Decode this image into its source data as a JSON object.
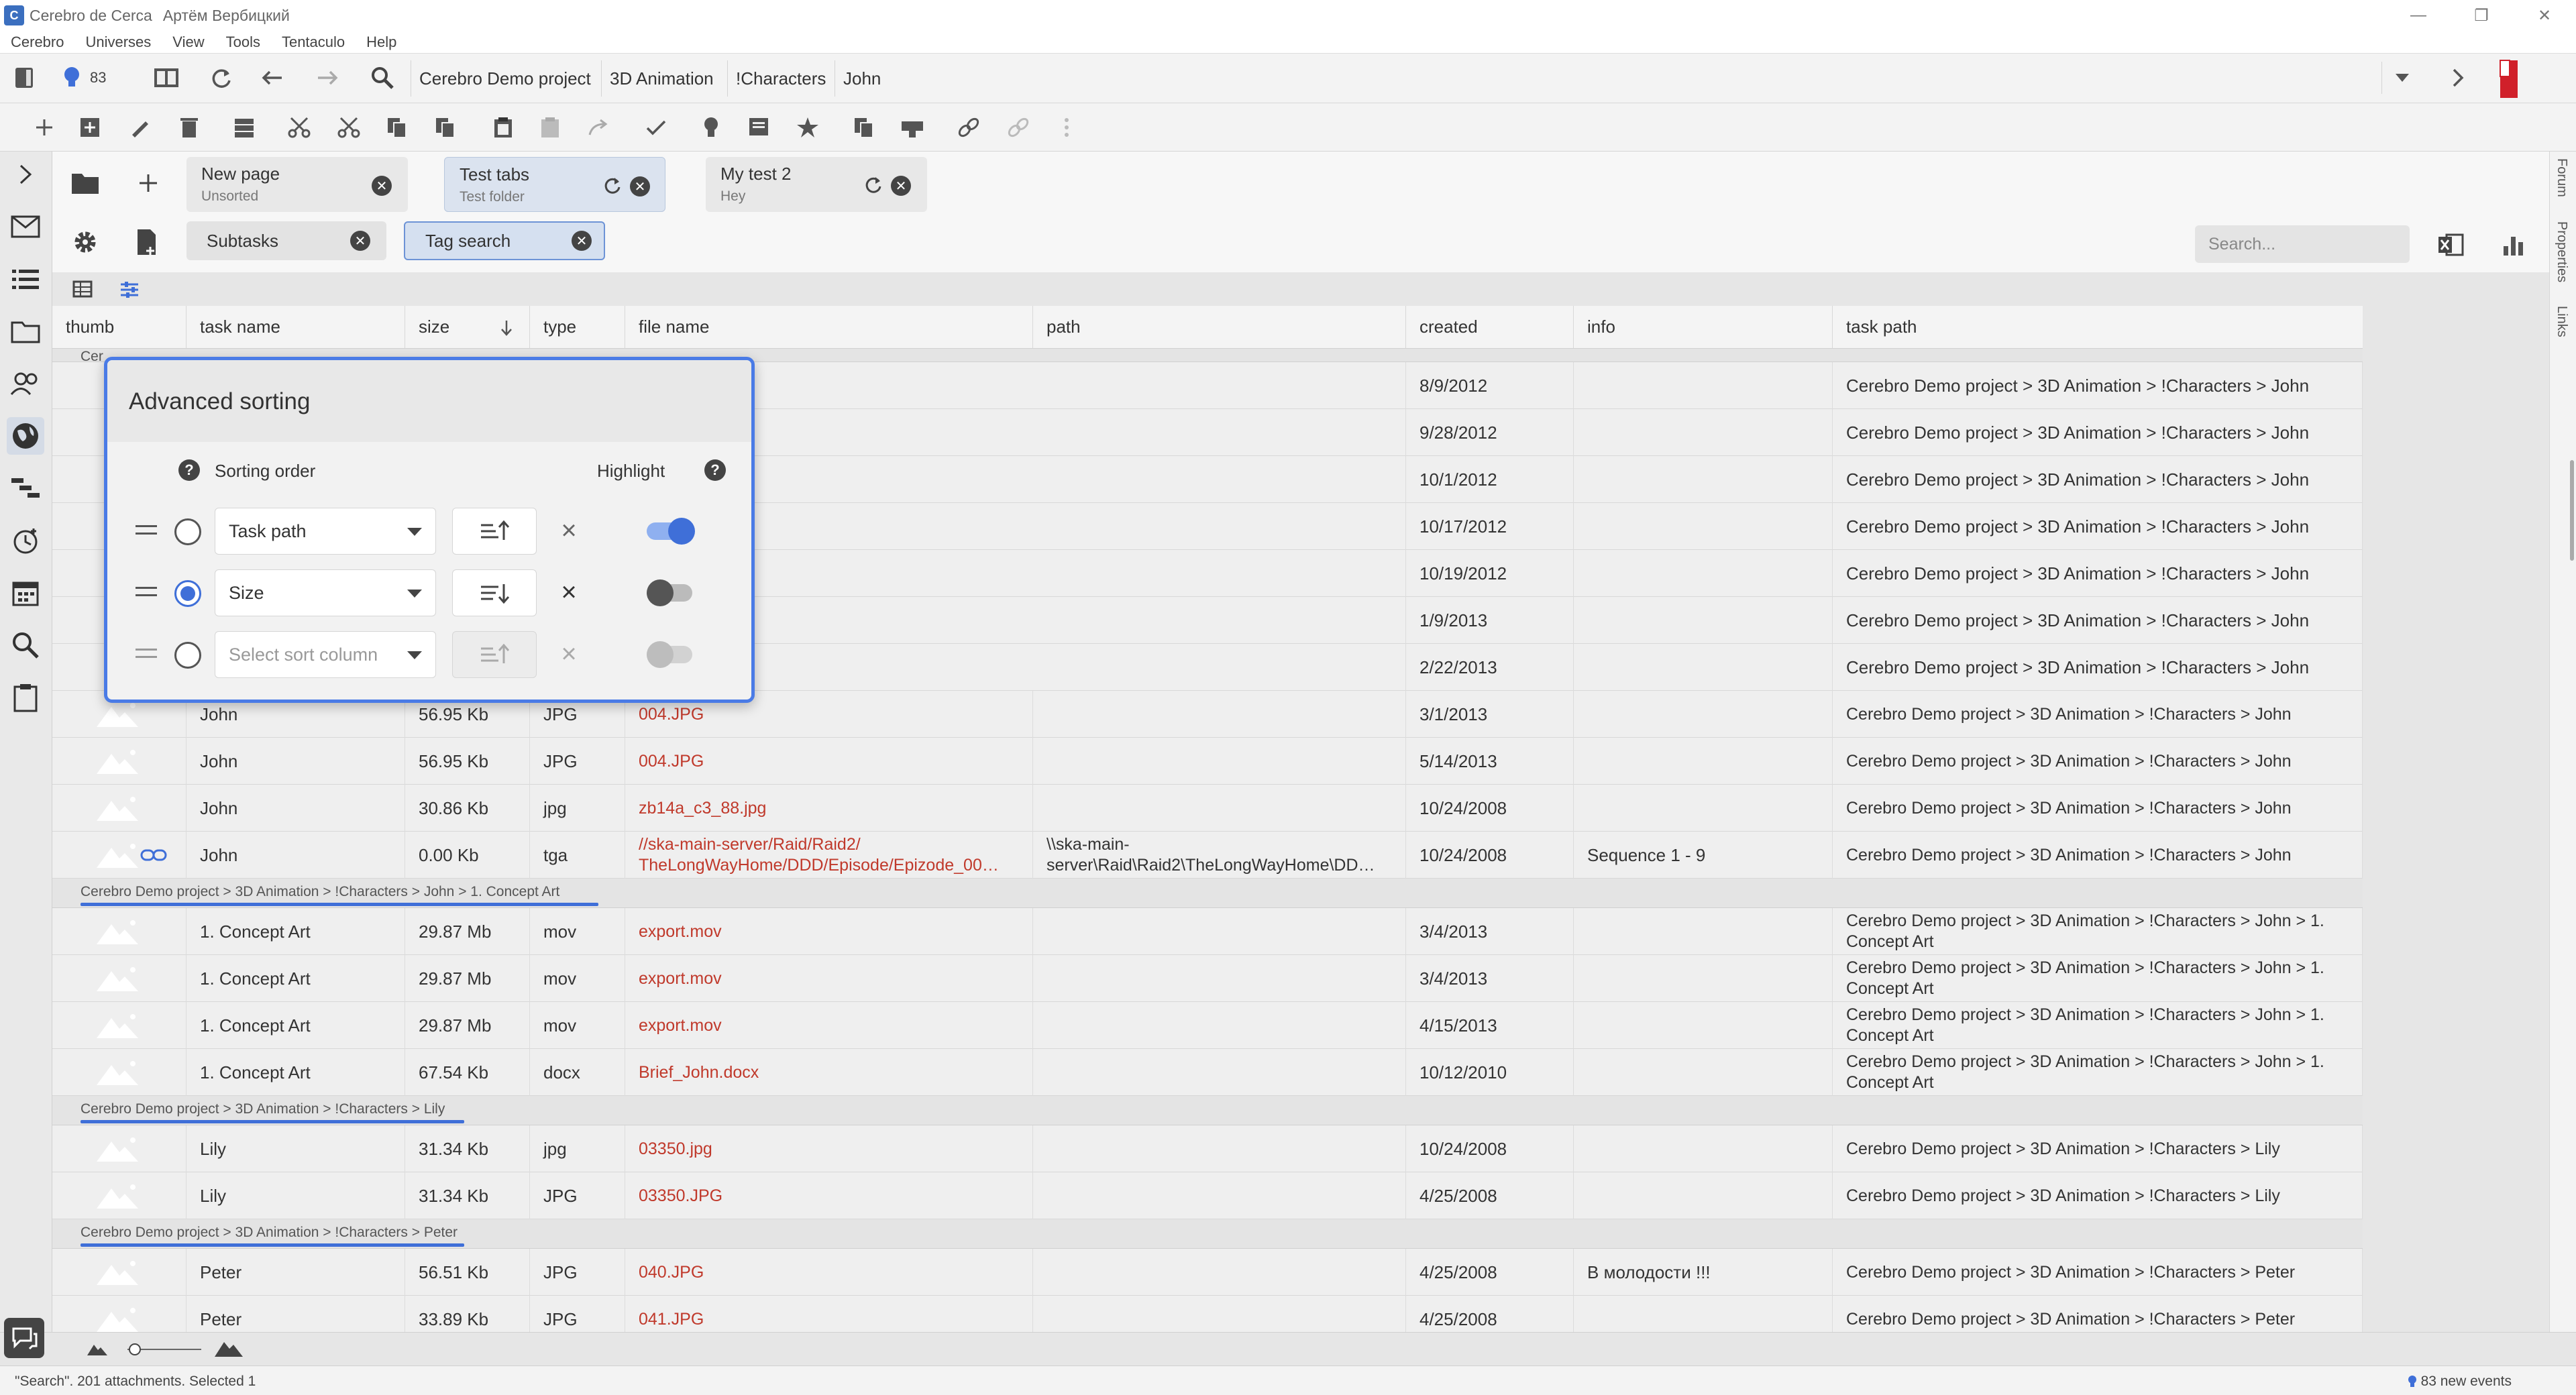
{
  "window": {
    "app_title": "Cerebro de Cerca",
    "user": "Артём Вербицкий"
  },
  "menu": [
    "Cerebro",
    "Universes",
    "View",
    "Tools",
    "Tentaculo",
    "Help"
  ],
  "navbar": {
    "notifications_count": "83",
    "breadcrumbs": [
      "Cerebro Demo project",
      "3D Animation",
      "!Characters",
      "John"
    ]
  },
  "right_tabs": [
    "Forum",
    "Properties",
    "Links"
  ],
  "page_tabs": [
    {
      "title": "New page",
      "subtitle": "Unsorted"
    },
    {
      "title": "Test tabs",
      "subtitle": "Test folder"
    },
    {
      "title": "My test 2",
      "subtitle": "Hey"
    }
  ],
  "sub_tabs": [
    "Subtasks",
    "Tag search"
  ],
  "search": {
    "placeholder": "Search..."
  },
  "columns": [
    "thumb",
    "task name",
    "size",
    "type",
    "file name",
    "path",
    "created",
    "info",
    "task path"
  ],
  "first_group_label": "Cer",
  "hidden_rows": [
    {
      "created": "8/9/2012",
      "task_path": "Cerebro Demo project > 3D Animation > !Characters > John"
    },
    {
      "created": "9/28/2012",
      "task_path": "Cerebro Demo project > 3D Animation > !Characters > John"
    },
    {
      "created": "10/1/2012",
      "task_path": "Cerebro Demo project > 3D Animation > !Characters > John"
    },
    {
      "created": "10/17/2012",
      "task_path": "Cerebro Demo project > 3D Animation > !Characters > John"
    },
    {
      "created": "10/19/2012",
      "task_path": "Cerebro Demo project > 3D Animation > !Characters > John"
    },
    {
      "created": "1/9/2013",
      "task_path": "Cerebro Demo project > 3D Animation > !Characters > John"
    },
    {
      "created": "2/22/2013",
      "task_path": "Cerebro Demo project > 3D Animation > !Characters > John"
    }
  ],
  "john_rows": [
    {
      "task_name": "John",
      "size": "56.95 Kb",
      "type": "JPG",
      "file_name": "004.JPG",
      "path": "",
      "created": "3/1/2013",
      "info": "",
      "task_path": "Cerebro Demo project > 3D Animation > !Characters > John"
    },
    {
      "task_name": "John",
      "size": "56.95 Kb",
      "type": "JPG",
      "file_name": "004.JPG",
      "path": "",
      "created": "5/14/2013",
      "info": "",
      "task_path": "Cerebro Demo project > 3D Animation > !Characters > John"
    },
    {
      "task_name": "John",
      "size": "30.86 Kb",
      "type": "jpg",
      "file_name": "zb14a_c3_88.jpg",
      "path": "",
      "created": "10/24/2008",
      "info": "",
      "task_path": "Cerebro Demo project > 3D Animation > !Characters > John"
    },
    {
      "task_name": "John",
      "size": "0.00 Kb",
      "type": "tga",
      "file_name": "//ska-main-server/Raid/Raid2/ TheLongWayHome/DDD/Episode/Epizode_00…",
      "path": "\\\\ska-main- server\\Raid\\Raid2\\TheLongWayHome\\DD…",
      "created": "10/24/2008",
      "info": "Sequence 1 - 9",
      "task_path": "Cerebro Demo project > 3D Animation > !Characters > John"
    }
  ],
  "groups": [
    {
      "label": "Cerebro Demo project > 3D Animation > !Characters > John > 1. Concept Art",
      "rows": [
        {
          "task_name": "1. Concept Art",
          "size": "29.87 Mb",
          "type": "mov",
          "file_name": "export.mov",
          "created": "3/4/2013",
          "info": "",
          "task_path": "Cerebro Demo project > 3D Animation > !Characters > John > 1. Concept Art"
        },
        {
          "task_name": "1. Concept Art",
          "size": "29.87 Mb",
          "type": "mov",
          "file_name": "export.mov",
          "created": "3/4/2013",
          "info": "",
          "task_path": "Cerebro Demo project > 3D Animation > !Characters > John > 1. Concept Art"
        },
        {
          "task_name": "1. Concept Art",
          "size": "29.87 Mb",
          "type": "mov",
          "file_name": "export.mov",
          "created": "4/15/2013",
          "info": "",
          "task_path": "Cerebro Demo project > 3D Animation > !Characters > John > 1. Concept Art"
        },
        {
          "task_name": "1. Concept Art",
          "size": "67.54 Kb",
          "type": "docx",
          "file_name": "Brief_John.docx",
          "created": "10/12/2010",
          "info": "",
          "task_path": "Cerebro Demo project > 3D Animation > !Characters > John > 1. Concept Art"
        }
      ]
    },
    {
      "label": "Cerebro Demo project > 3D Animation > !Characters > Lily",
      "rows": [
        {
          "task_name": "Lily",
          "size": "31.34 Kb",
          "type": "jpg",
          "file_name": "03350.jpg",
          "created": "10/24/2008",
          "info": "",
          "task_path": "Cerebro Demo project > 3D Animation > !Characters > Lily"
        },
        {
          "task_name": "Lily",
          "size": "31.34 Kb",
          "type": "JPG",
          "file_name": "03350.JPG",
          "created": "4/25/2008",
          "info": "",
          "task_path": "Cerebro Demo project > 3D Animation > !Characters > Lily"
        }
      ]
    },
    {
      "label": "Cerebro Demo project > 3D Animation > !Characters > Peter",
      "rows": [
        {
          "task_name": "Peter",
          "size": "56.51 Kb",
          "type": "JPG",
          "file_name": "040.JPG",
          "created": "4/25/2008",
          "info": "В молодости !!!",
          "task_path": "Cerebro Demo project > 3D Animation > !Characters > Peter"
        },
        {
          "task_name": "Peter",
          "size": "33.89 Kb",
          "type": "JPG",
          "file_name": "041.JPG",
          "created": "4/25/2008",
          "info": "",
          "task_path": "Cerebro Demo project > 3D Animation > !Characters > Peter"
        }
      ]
    }
  ],
  "sort_panel": {
    "title": "Advanced sorting",
    "sorting_order_label": "Sorting order",
    "highlight_label": "Highlight",
    "rows": [
      {
        "column": "Task path",
        "direction": "ascending",
        "selected": false,
        "highlight": true
      },
      {
        "column": "Size",
        "direction": "descending",
        "selected": true,
        "highlight": false
      },
      {
        "column": "Select sort column",
        "direction": "ascending",
        "selected": false,
        "highlight": false,
        "placeholder": true
      }
    ]
  },
  "status": {
    "text": "\"Search\". 201 attachments. Selected 1",
    "events": "83 new events"
  },
  "colors": {
    "accent": "#3f6fd8",
    "link": "#c0392b",
    "brand_red": "#d0202a"
  }
}
